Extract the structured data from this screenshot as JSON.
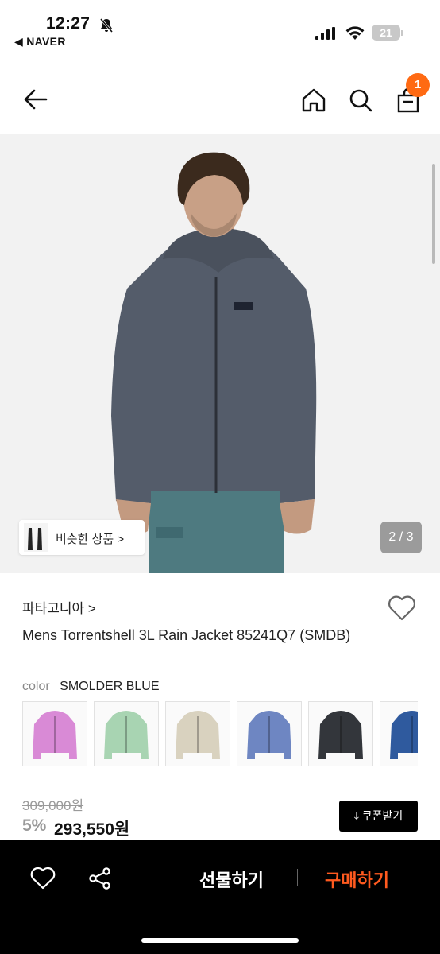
{
  "status_bar": {
    "time": "12:27",
    "back_app": "◀ NAVER",
    "battery_level": "21",
    "icons": [
      "bell-slash-icon",
      "signal-icon",
      "wifi-icon",
      "battery-icon"
    ]
  },
  "header": {
    "icons": [
      "back-arrow-icon",
      "home-icon",
      "search-icon",
      "shopping-bag-icon"
    ],
    "cart_count": "1",
    "accent_color": "#ff6a13"
  },
  "gallery": {
    "similar_label": "비슷한 상품 >",
    "counter": "2 / 3"
  },
  "product": {
    "brand": "파타고니아 >",
    "title": "Mens Torrentshell 3L Rain Jacket 85241Q7 (SMDB)",
    "color_label": "color",
    "color_value": "SMOLDER BLUE",
    "swatch_colors": [
      "#d98ad6",
      "#a8d4b2",
      "#d9d2bf",
      "#6e86c2",
      "#33363b",
      "#2f5a9e"
    ],
    "original_price": "309,000원",
    "discount": "5%",
    "price": "293,550원",
    "coupon_label": "⤓ 쿠폰받기"
  },
  "bottom_bar": {
    "icons": [
      "heart-icon",
      "share-icon"
    ],
    "gift_label": "선물하기",
    "buy_label": "구매하기",
    "buy_color": "#ff5a1f"
  }
}
